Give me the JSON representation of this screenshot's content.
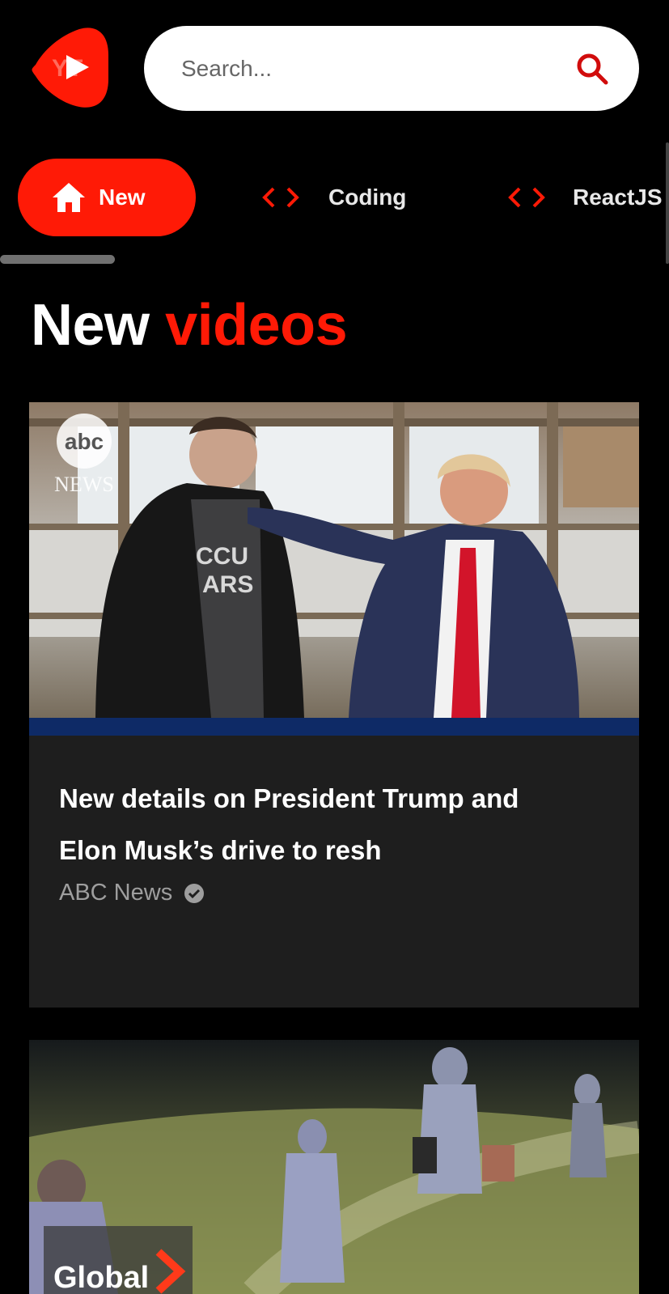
{
  "app": {
    "logo_icon": "youtube-play-logo",
    "brand_color": "#ff1a06"
  },
  "search": {
    "placeholder": "Search...",
    "icon": "search-icon",
    "icon_color": "#d10c0c"
  },
  "categories": [
    {
      "label": "New",
      "icon": "home-icon",
      "active": true
    },
    {
      "label": "Coding",
      "icon": "code-icon",
      "active": false
    },
    {
      "label": "ReactJS",
      "icon": "code-icon",
      "active": false
    }
  ],
  "section": {
    "title_part1": "New",
    "title_part2": "videos"
  },
  "videos": [
    {
      "title_line1": "New details on President Trump and",
      "title_line2": "Elon Musk’s drive to resh",
      "channel": "ABC News",
      "verified": true,
      "thumbnail_watermark_logo": "abc",
      "thumbnail_watermark_text": "NEWS"
    },
    {
      "thumbnail_watermark_text": "Global"
    }
  ]
}
